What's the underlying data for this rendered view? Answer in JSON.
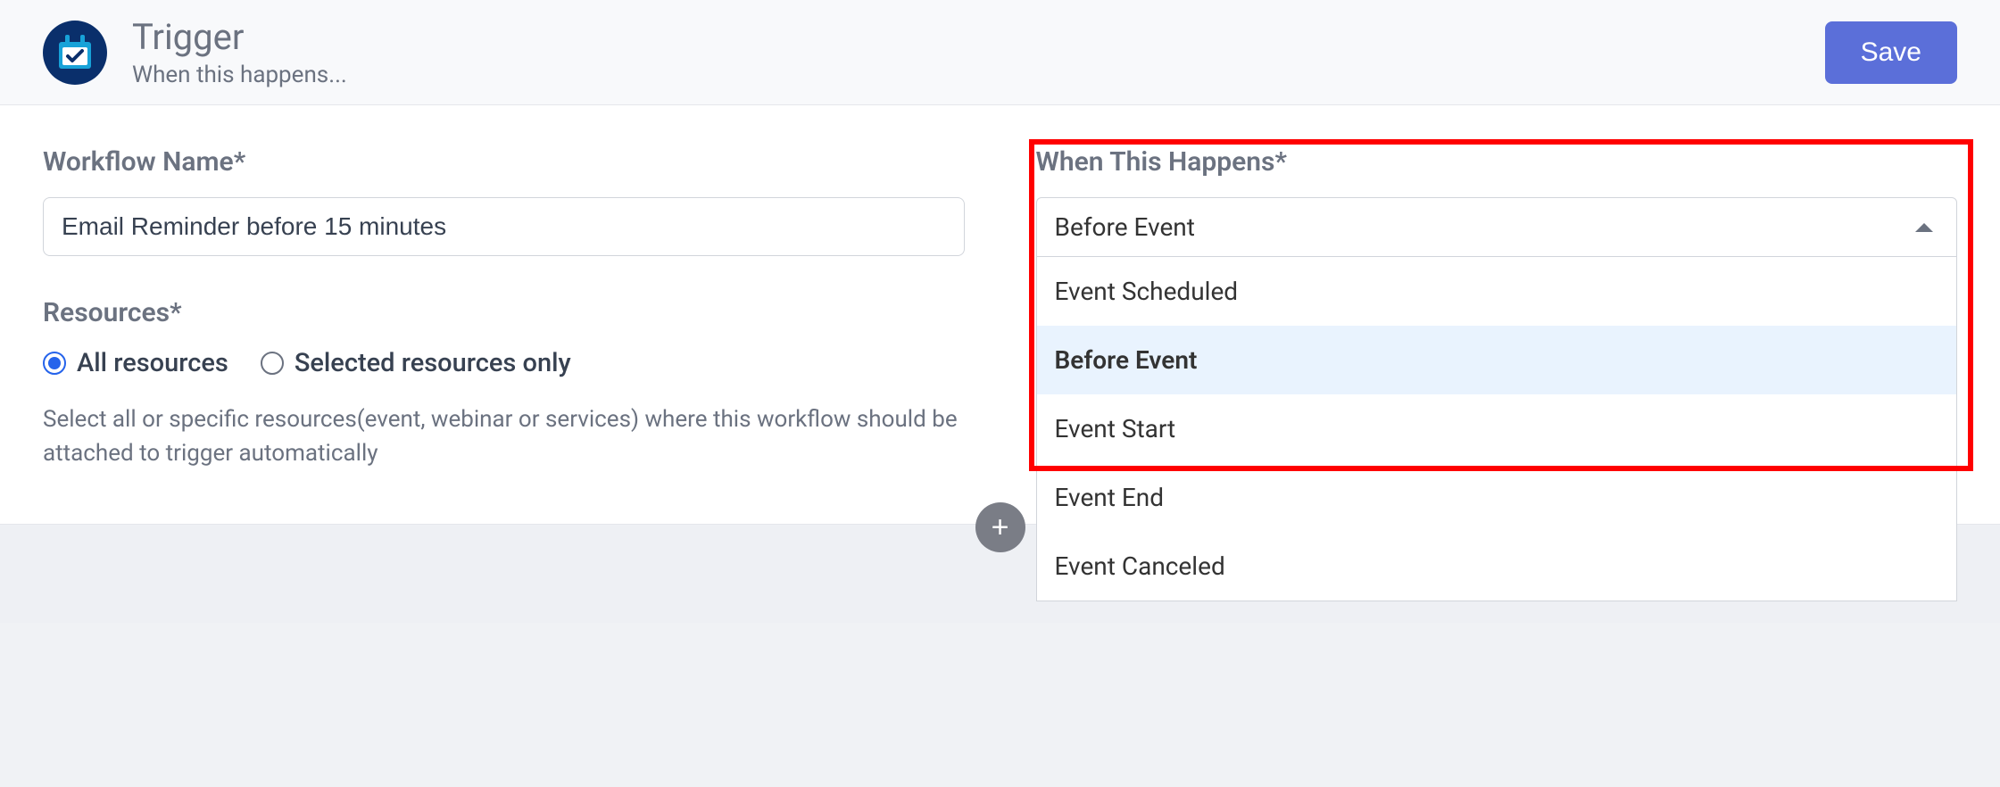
{
  "header": {
    "title": "Trigger",
    "subtitle": "When this happens...",
    "save_label": "Save"
  },
  "form": {
    "workflow_name_label": "Workflow Name*",
    "workflow_name_value": "Email Reminder before 15 minutes",
    "resources_label": "Resources*",
    "resources_options": {
      "all": "All resources",
      "selected": "Selected resources only"
    },
    "resources_helper": "Select all or specific resources(event, webinar or services) where this workflow should be attached to trigger automatically",
    "when_label": "When This Happens*",
    "when_selected": "Before Event",
    "when_options": [
      "Event Scheduled",
      "Before Event",
      "Event Start",
      "Event End",
      "Event Canceled"
    ]
  },
  "icons": {
    "trigger": "calendar-check-icon",
    "add": "plus-icon",
    "dropdown_arrow": "chevron-up-icon"
  },
  "colors": {
    "primary_button": "#5b6fd9",
    "highlight_border": "#ff0000",
    "radio_checked": "#2563eb"
  }
}
